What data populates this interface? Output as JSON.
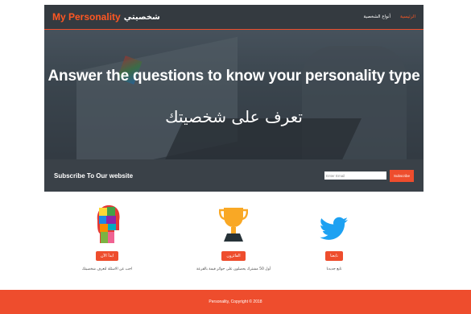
{
  "navbar": {
    "brand_en": "My Personality",
    "brand_ar": "شخصيتي",
    "links": [
      {
        "label": "الرئيسية",
        "active": true
      },
      {
        "label": "أنواع الشخصية",
        "active": false
      }
    ]
  },
  "hero": {
    "title": "Answer the questions to know your personality type",
    "subtitle": "تعرف على شخصيتك"
  },
  "subscribe": {
    "label": "Subscribe To Our website",
    "email_placeholder": "Enter Email",
    "button_label": "Subscribe"
  },
  "features": [
    {
      "icon": "head-puzzle-icon",
      "button": "ابدأ الآن",
      "desc": "اجب عن الاسئلة لتعرف شخصيتك"
    },
    {
      "icon": "trophy-icon",
      "button": "الفائزون",
      "desc": "أول 50 مشترك يحصلون على جوائز قيمة بالقرعة"
    },
    {
      "icon": "twitter-icon",
      "button": "تابعنا",
      "desc": "تابع جديدنا"
    }
  ],
  "footer": {
    "text": "Personality, Copyright © 2018"
  },
  "colors": {
    "accent": "#ee4d2d",
    "dark": "#343a40"
  }
}
